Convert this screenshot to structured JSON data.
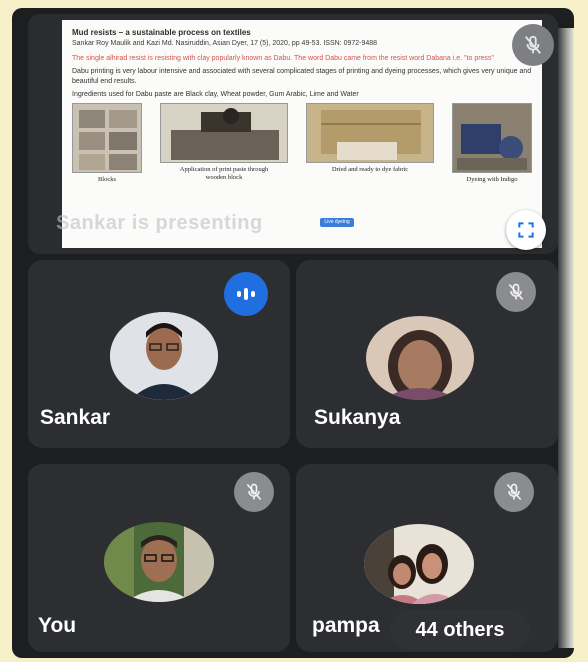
{
  "presentation": {
    "presenter_label": "Sankar is presenting",
    "slide": {
      "title": "Mud resists – a sustainable process on textiles",
      "citation": "Sankar Roy Maulik and Kazi Md. Nasiruddin, Asian Dyer, 17 (5), 2020, pp 49-53. ISSN: 0972-9488",
      "red_text": "The single alhirad resist is resisting with clay popularly known as Dabu. The word Dabu came from the resist word Dabana i.e. \"to press\"",
      "body_1": "Dabu printing is very labour intensive and associated with several complicated stages of printing and dyeing processes, which gives very unique and beautiful end results.",
      "body_2": "Ingredients used for Dabu paste are Black clay, Wheat powder, Gum Arabic, Lime and Water",
      "images": [
        {
          "caption": "Blocks"
        },
        {
          "caption": "Application of print paste through wooden block"
        },
        {
          "caption": "Dried and ready to dye fabric"
        },
        {
          "caption": "Dyeing with Indigo"
        }
      ],
      "chip_label": "Live dyeing"
    },
    "mic_icon": "mic-off-icon",
    "fullscreen_icon": "fullscreen-icon"
  },
  "participants": [
    {
      "name": "Sankar",
      "status": "speaking",
      "status_icon": "audio-level-icon"
    },
    {
      "name": "Sukanya",
      "status": "muted",
      "status_icon": "mic-off-icon"
    },
    {
      "name": "You",
      "status": "muted",
      "status_icon": "mic-off-icon"
    },
    {
      "name": "pampa",
      "status": "muted",
      "status_icon": "mic-off-icon"
    }
  ],
  "others": {
    "label": "44 others"
  },
  "colors": {
    "tile_bg": "#2d2e31",
    "speaking_blue": "#1f6fe0",
    "mic_off_gray": "#8a8c90"
  }
}
